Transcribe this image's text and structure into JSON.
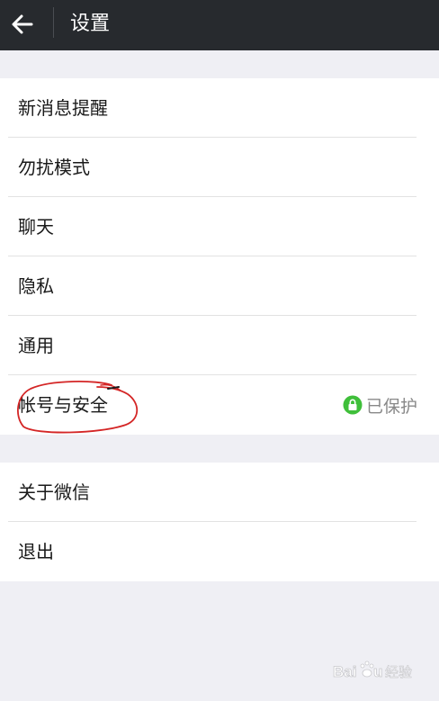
{
  "header": {
    "title": "设置",
    "back_icon": "arrow-left-icon",
    "background": "#272a2e"
  },
  "group1": {
    "items": [
      {
        "label": "新消息提醒"
      },
      {
        "label": "勿扰模式"
      },
      {
        "label": "聊天"
      },
      {
        "label": "隐私"
      },
      {
        "label": "通用"
      },
      {
        "label": "帐号与安全",
        "status": "已保护",
        "status_icon": "lock-icon",
        "status_color": "#3fbf3a"
      }
    ]
  },
  "group2": {
    "items": [
      {
        "label": "关于微信"
      },
      {
        "label": "退出"
      }
    ]
  },
  "annotation_color": "#d42626",
  "watermark": "Baidu 经验"
}
